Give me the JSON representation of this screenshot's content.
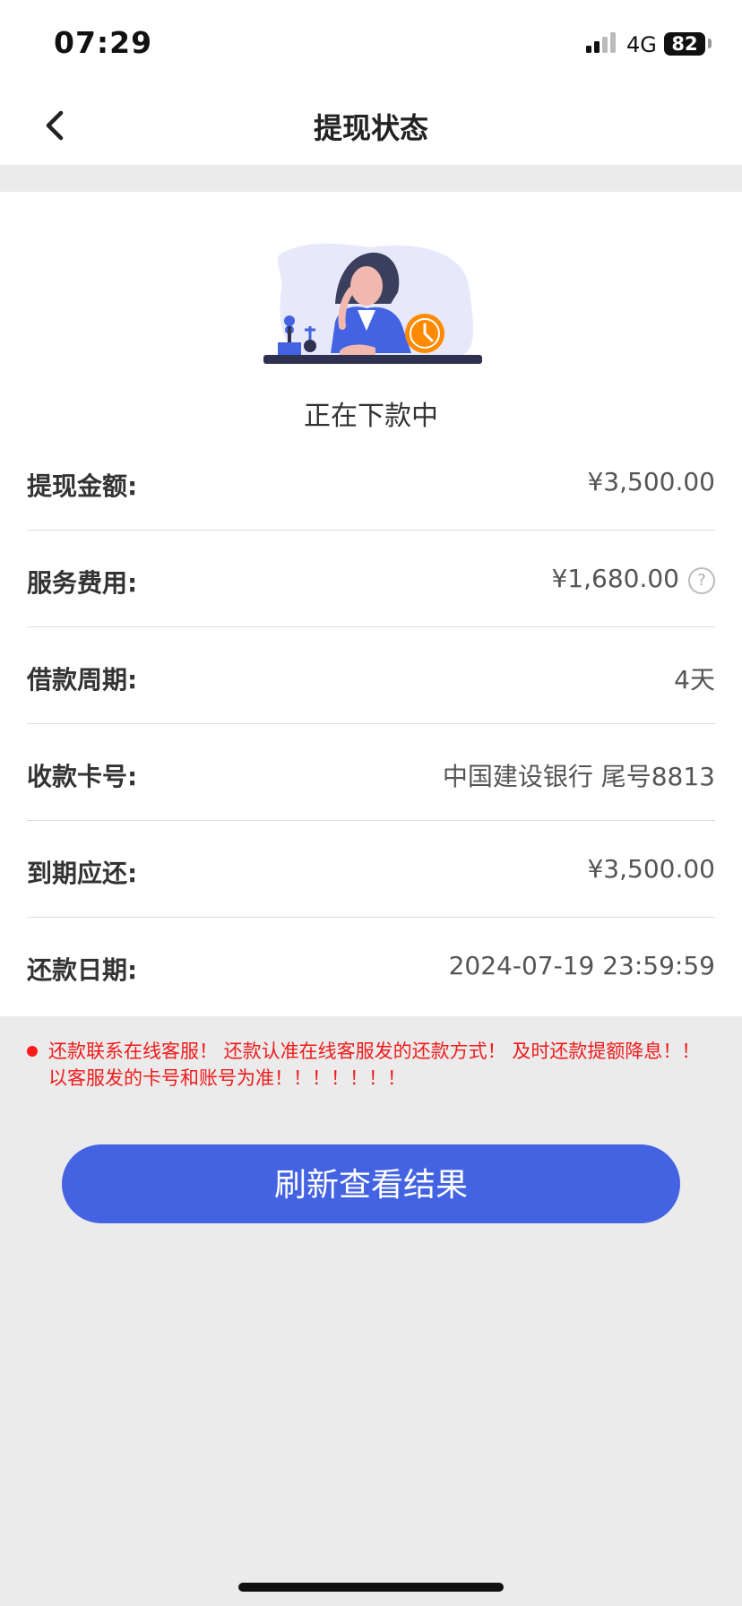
{
  "status_bar": {
    "time": "07:29",
    "network": "4G",
    "battery": "82"
  },
  "nav": {
    "title": "提现状态",
    "back_icon": "chevron-left-icon"
  },
  "status": {
    "text": "正在下款中",
    "illustration": "woman-waiting-clock-illustration"
  },
  "rows": [
    {
      "label": "提现金额:",
      "value": "¥3,500.00"
    },
    {
      "label": "服务费用:",
      "value": "¥1,680.00",
      "help_icon": "question-circle-icon",
      "help_text": "?"
    },
    {
      "label": "借款周期:",
      "value": "4天"
    },
    {
      "label": "收款卡号:",
      "value": "中国建设银行 尾号8813"
    },
    {
      "label": "到期应还:",
      "value": "¥3,500.00"
    },
    {
      "label": "还款日期:",
      "value": "2024-07-19 23:59:59"
    }
  ],
  "notice": {
    "text": "还款联系在线客服！ 还款认准在线客服发的还款方式！ 及时还款提额降息！！ 以客服发的卡号和账号为准！！！！！！！",
    "color": "#f01b1b"
  },
  "action": {
    "refresh_label": "刷新查看结果",
    "color": "#4363e3"
  }
}
